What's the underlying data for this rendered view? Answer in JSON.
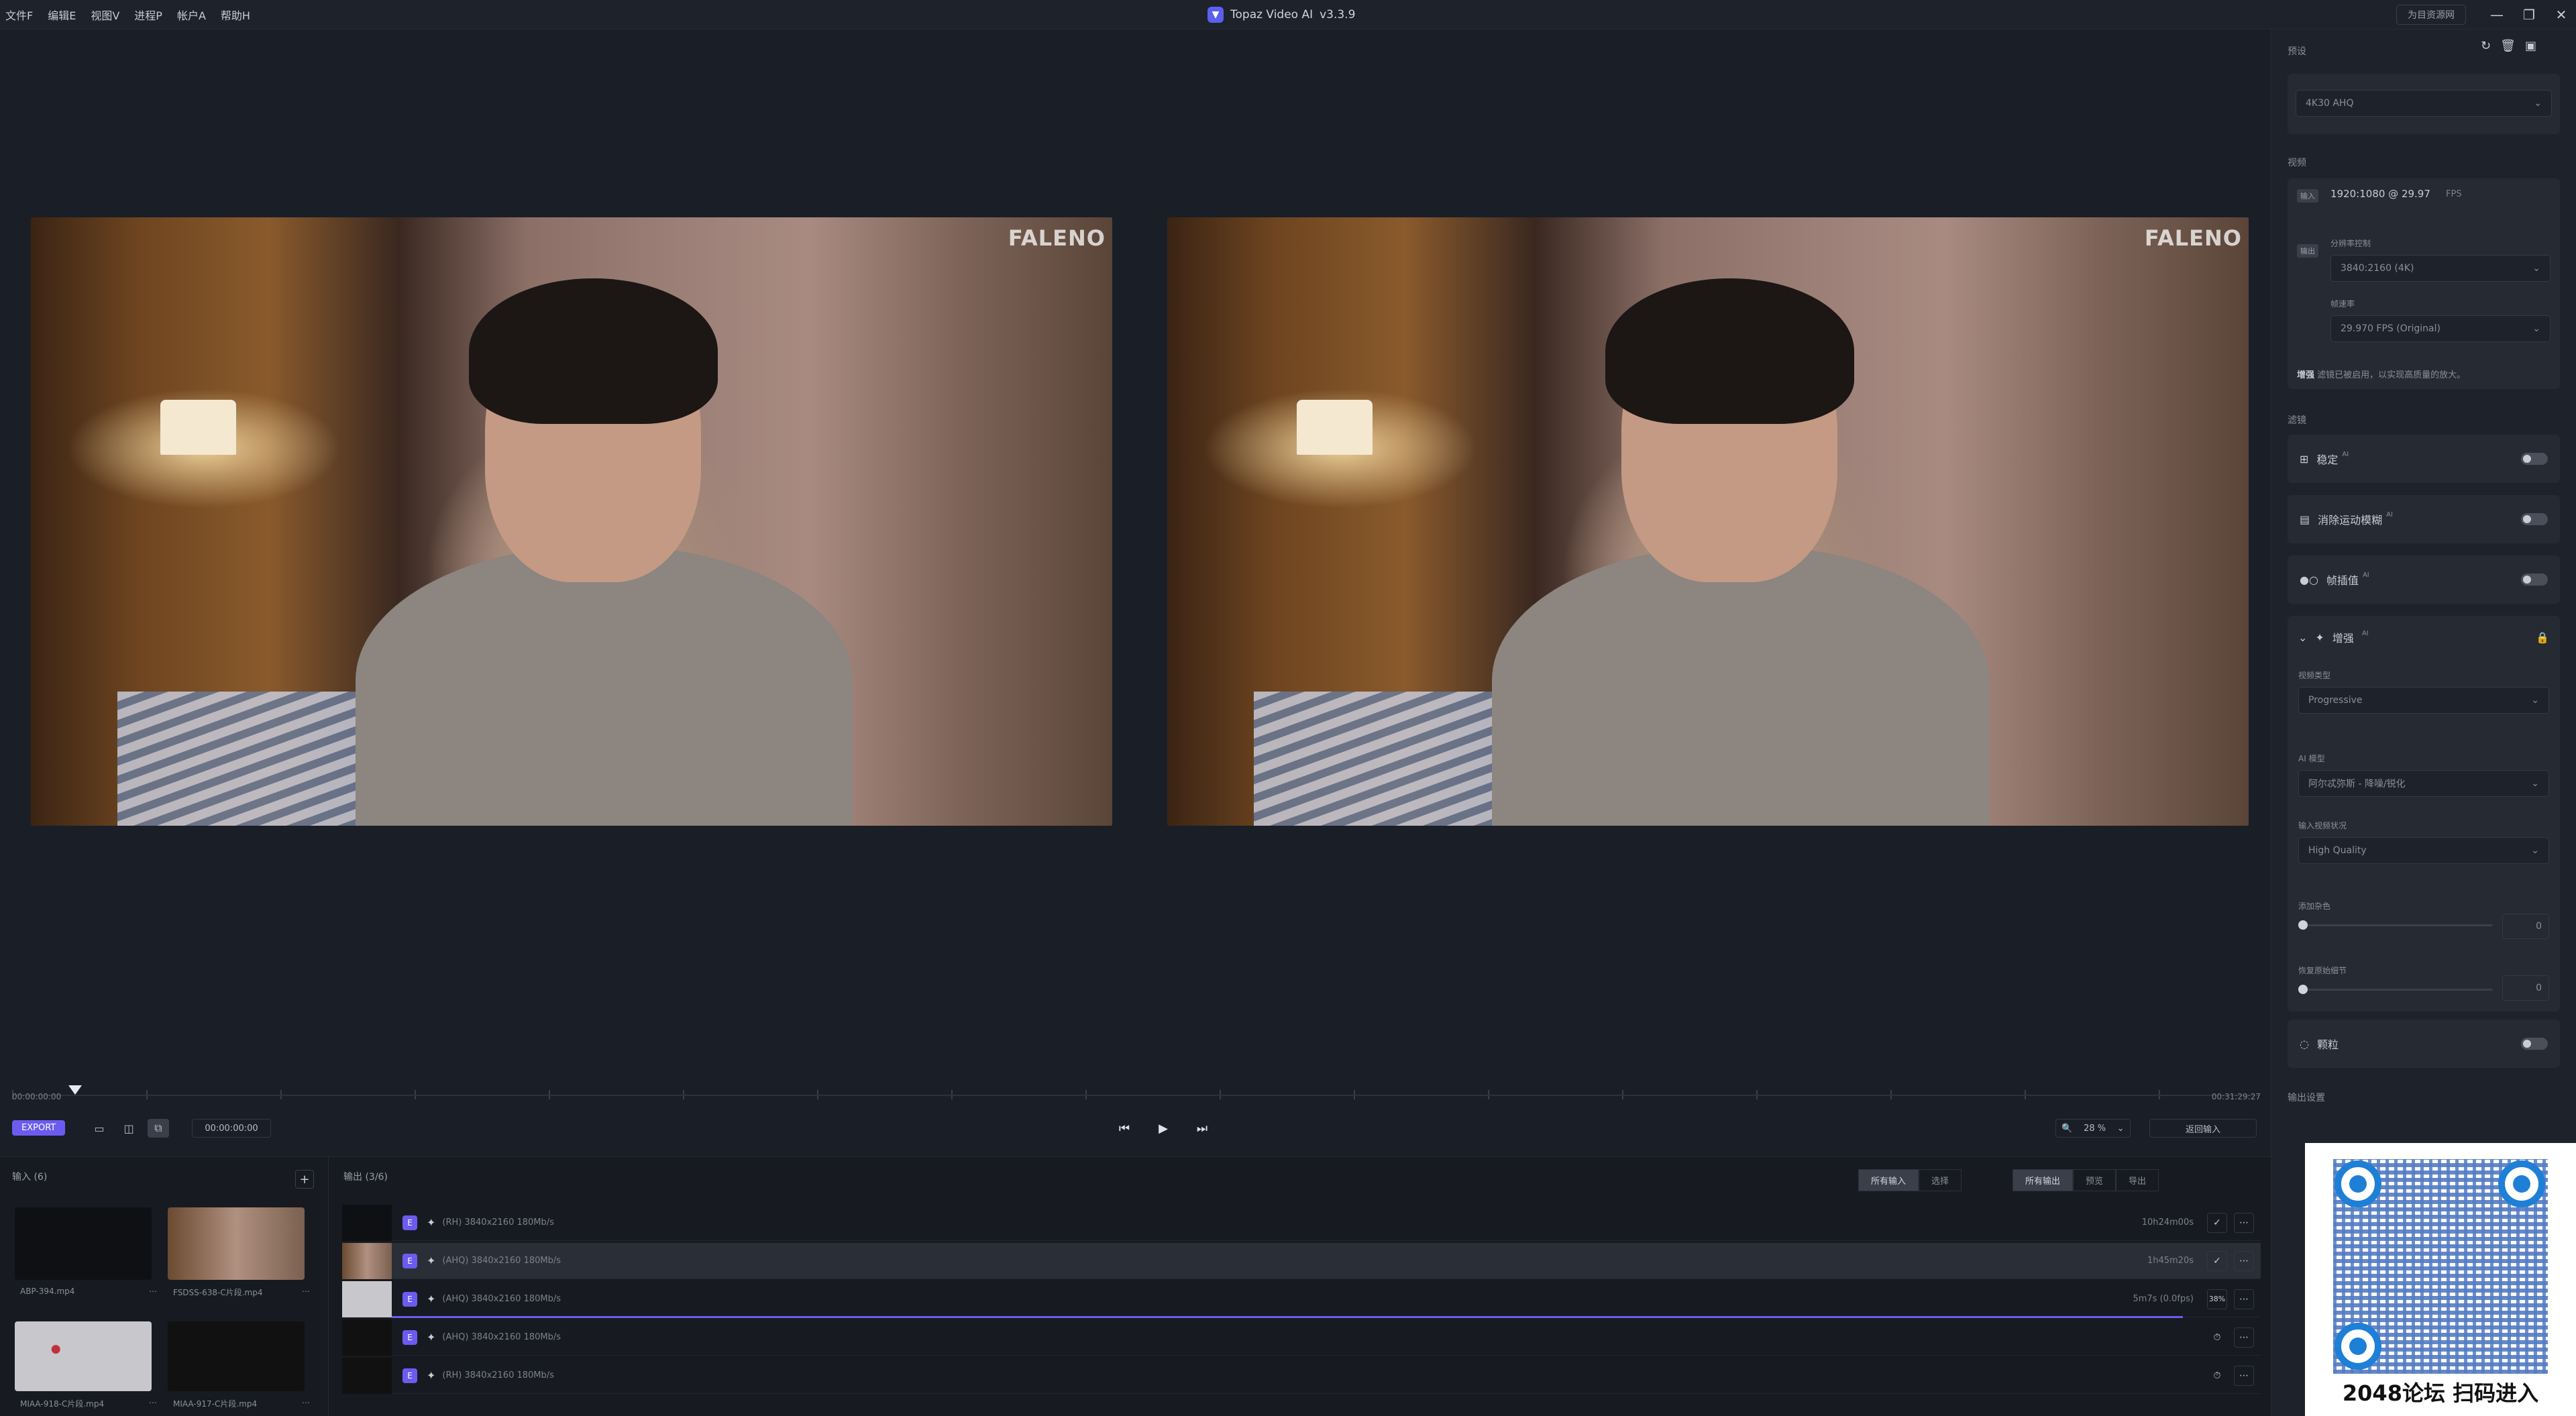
{
  "menu": [
    "文件F",
    "编辑E",
    "视图V",
    "进程P",
    "帐户A",
    "帮助H"
  ],
  "app_title": "Topaz Video AI",
  "app_version": "v3.3.9",
  "header_pill": "为目资源网",
  "window_controls": {
    "minimize": "—",
    "maximize": "❐",
    "close": "✕"
  },
  "watermark": "FALENO",
  "timeline": {
    "start": "00:00:00:00",
    "end": "00:31:29:27",
    "current": "00:00:00:00"
  },
  "controls": {
    "export": "EXPORT",
    "zoom": "28 %",
    "return_input": "返回输入"
  },
  "input_panel": {
    "title": "输入 (6)",
    "items": [
      {
        "name": "ABP-394.mp4"
      },
      {
        "name": "FSDSS-638-C片段.mp4"
      },
      {
        "name": "MIAA-918-C片段.mp4"
      },
      {
        "name": "MIAA-917-C片段.mp4"
      }
    ]
  },
  "output_panel": {
    "title": "输出 (3/6)",
    "filters_left": [
      "所有输入",
      "选择"
    ],
    "filters_right": [
      "所有输出",
      "预览",
      "导出"
    ],
    "rows": [
      {
        "badge": "E",
        "desc": "(RH) 3840x2160 180Mb/s",
        "time": "10h24m00s",
        "status": "✓"
      },
      {
        "badge": "E",
        "desc": "(AHQ) 3840x2160 180Mb/s",
        "time": "1h45m20s",
        "status": "✓"
      },
      {
        "badge": "E",
        "desc": "(AHQ) 3840x2160 180Mb/s",
        "time": "5m7s (0.0fps)",
        "status": "38%"
      },
      {
        "badge": "E",
        "desc": "(AHQ) 3840x2160 180Mb/s",
        "time": "",
        "status": "⏱"
      },
      {
        "badge": "E",
        "desc": "(RH) 3840x2160 180Mb/s",
        "time": "",
        "status": "⏱"
      }
    ]
  },
  "right_panel": {
    "preset_label": "预设",
    "preset_value": "4K30 AHQ",
    "video_label": "视频",
    "input_tag": "输入",
    "input_value": "1920:1080 @ 29.97",
    "input_fps_unit": "FPS",
    "output_tag": "输出",
    "resolution_label": "分辨率控制",
    "resolution_value": "3840:2160 (4K)",
    "framerate_label": "帧速率",
    "framerate_value": "29.970 FPS (Original)",
    "enhance_note_tag": "增强",
    "enhance_note": "滤镜已被启用，以实现高质量的放大。",
    "filters_label": "滤镜",
    "filters": [
      {
        "label": "稳定",
        "ai": "AI"
      },
      {
        "label": "消除运动模糊",
        "ai": "AI"
      },
      {
        "label": "帧插值",
        "ai": "AI"
      }
    ],
    "enhance_title": "增强",
    "enhance_ai": "AI",
    "video_type_label": "视频类型",
    "video_type_value": "Progressive",
    "ai_model_label": "AI 模型",
    "ai_model_value": "阿尔忒弥斯 - 降噪/锐化",
    "input_condition_label": "输入视频状况",
    "input_condition_value": "High Quality",
    "add_noise_label": "添加杂色",
    "add_noise_value": "0",
    "recover_detail_label": "恢复原始细节",
    "recover_detail_value": "0",
    "grain_label": "颗粒",
    "output_settings_label": "输出设置"
  },
  "qr_caption": "2048论坛 扫码进入"
}
